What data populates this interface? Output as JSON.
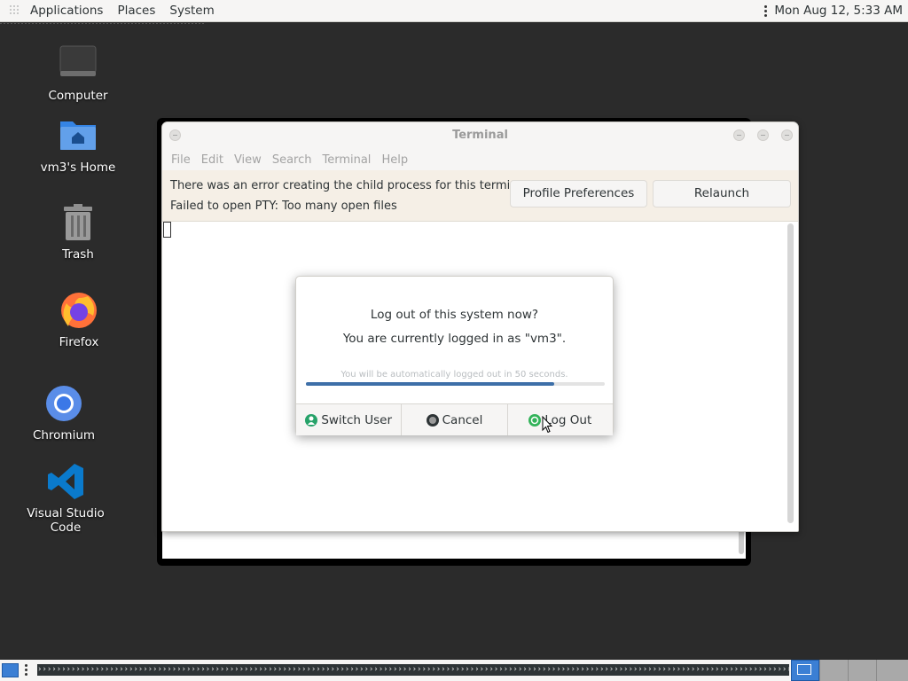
{
  "top_panel": {
    "menus": [
      "Applications",
      "Places",
      "System"
    ],
    "clock": "Mon Aug 12,  5:33 AM"
  },
  "desktop": {
    "icons": [
      {
        "label": "Computer",
        "icon": "computer-icon"
      },
      {
        "label": "vm3's Home",
        "icon": "home-folder-icon"
      },
      {
        "label": "Trash",
        "icon": "trash-icon"
      },
      {
        "label": "Firefox",
        "icon": "firefox-icon"
      },
      {
        "label": "Chromium",
        "icon": "chromium-icon"
      },
      {
        "label": "Visual Studio Code",
        "icon": "vscode-icon"
      }
    ]
  },
  "terminal": {
    "title": "Terminal",
    "menu": [
      "File",
      "Edit",
      "View",
      "Search",
      "Terminal",
      "Help"
    ],
    "infobar": {
      "line1": "There was an error creating the child process for this terminal",
      "line2": "Failed to open PTY: Too many open files",
      "profile_button": "Profile Preferences",
      "relaunch_button": "Relaunch"
    }
  },
  "logout_dialog": {
    "title": "Log out of this system now?",
    "subtitle": "You are currently logged in as \"vm3\".",
    "countdown": "You will be automatically logged out in 50 seconds.",
    "progress": 0.83,
    "buttons": {
      "switch_user": "Switch User",
      "cancel": "Cancel",
      "log_out": "Log Out"
    }
  },
  "bottom_panel": {
    "taskbar_text": "›››››››››››››››››››››››››››››››››››››››››››››››››››››››››››››››››››››››››››››››››››››››››››››››››››››››››››››››››››››››››››››››››››››››››››››››››››››››››››››››››››››››››››››››››››››››››››››››››››››››››",
    "workspaces": 4
  },
  "colors": {
    "accent": "#3b7fd4",
    "progress": "#3d6fa8",
    "desktop_bg": "#2b2b2b",
    "infobar_bg": "#f5efe6"
  }
}
